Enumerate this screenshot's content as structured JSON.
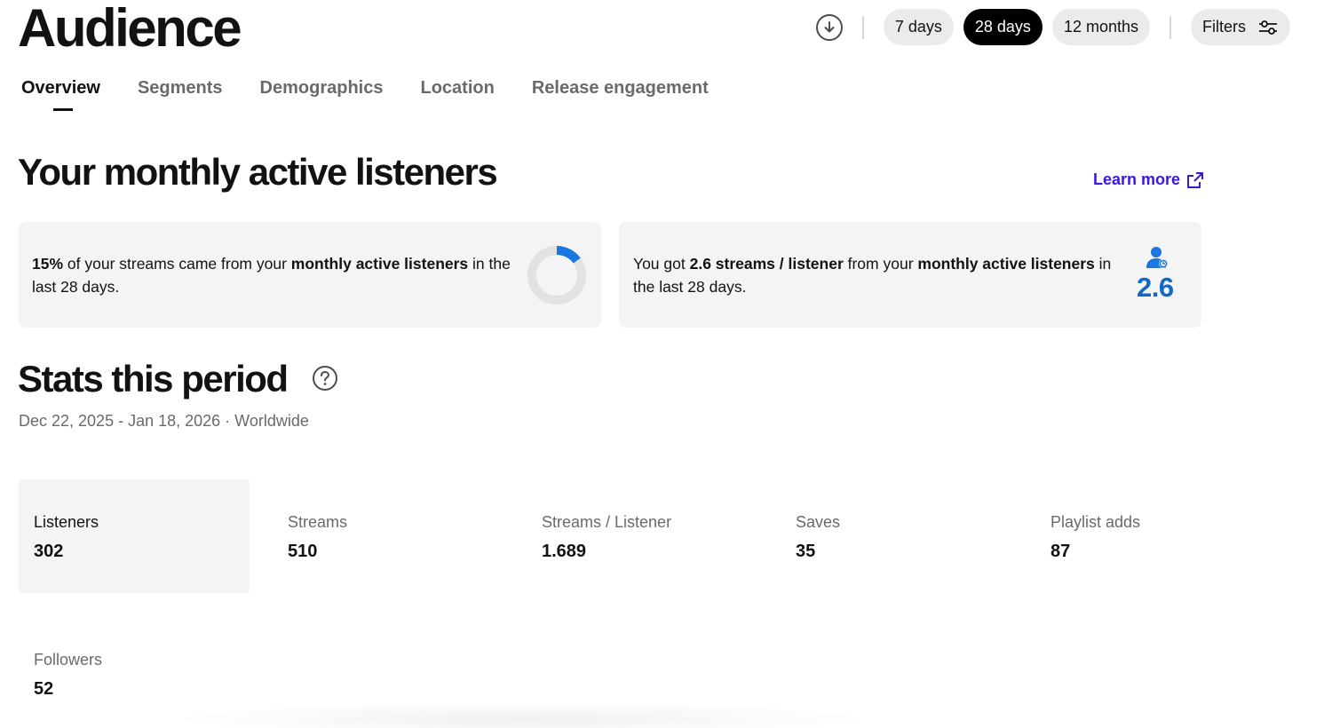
{
  "header": {
    "title": "Audience"
  },
  "toolbar": {
    "download_icon": "download-circle-icon",
    "ranges": [
      {
        "label": "7 days",
        "active": false
      },
      {
        "label": "28 days",
        "active": true
      },
      {
        "label": "12 months",
        "active": false
      }
    ],
    "filters_label": "Filters",
    "filters_icon": "sliders-icon"
  },
  "tabs": [
    {
      "label": "Overview",
      "active": true
    },
    {
      "label": "Segments"
    },
    {
      "label": "Demographics"
    },
    {
      "label": "Location"
    },
    {
      "label": "Release engagement"
    }
  ],
  "mal": {
    "title": "Your monthly active listeners",
    "learn_more": "Learn more",
    "card1": {
      "percent": "15%",
      "t1": " of your streams came from your ",
      "strong": "monthly active listeners",
      "t2": " in the last 28 days.",
      "donut_fraction": 0.15
    },
    "card2": {
      "t1": "You got ",
      "strong1": "2.6 streams / listener",
      "t2": " from your ",
      "strong2": "monthly active listeners",
      "t3": " in the last 28 days.",
      "big_value": "2.6"
    }
  },
  "stats": {
    "title": "Stats this period",
    "period": "Dec 22, 2025 - Jan 18, 2026 · Worldwide",
    "items": [
      {
        "label": "Listeners",
        "value": "302",
        "selected": true
      },
      {
        "label": "Streams",
        "value": "510"
      },
      {
        "label": "Streams / Listener",
        "value": "1.689"
      },
      {
        "label": "Saves",
        "value": "35"
      },
      {
        "label": "Playlist adds",
        "value": "87"
      },
      {
        "label": "Followers",
        "value": "52"
      }
    ]
  },
  "colors": {
    "accent_link": "#3d14e8",
    "highlight_blue": "#1068c8",
    "active_pill": "#000000"
  }
}
